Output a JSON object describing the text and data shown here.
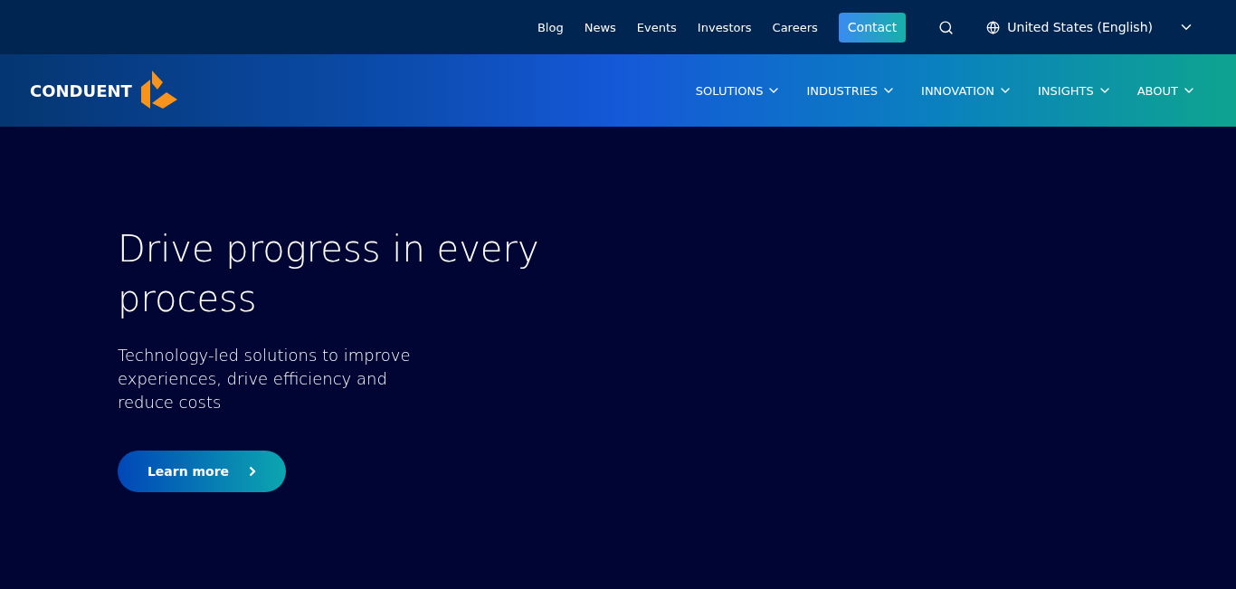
{
  "top_bar": {
    "links": [
      "Blog",
      "News",
      "Events",
      "Investors",
      "Careers"
    ],
    "contact": "Contact",
    "region": "United States (English)"
  },
  "main_nav": {
    "logo": "CONDUENT",
    "items": [
      "SOLUTIONS",
      "INDUSTRIES",
      "INNOVATION",
      "INSIGHTS",
      "ABOUT"
    ]
  },
  "hero": {
    "title": "Drive progress in every process",
    "subtitle": "Technology-led solutions to improve experiences, drive efficiency and reduce costs",
    "button": "Learn more"
  }
}
